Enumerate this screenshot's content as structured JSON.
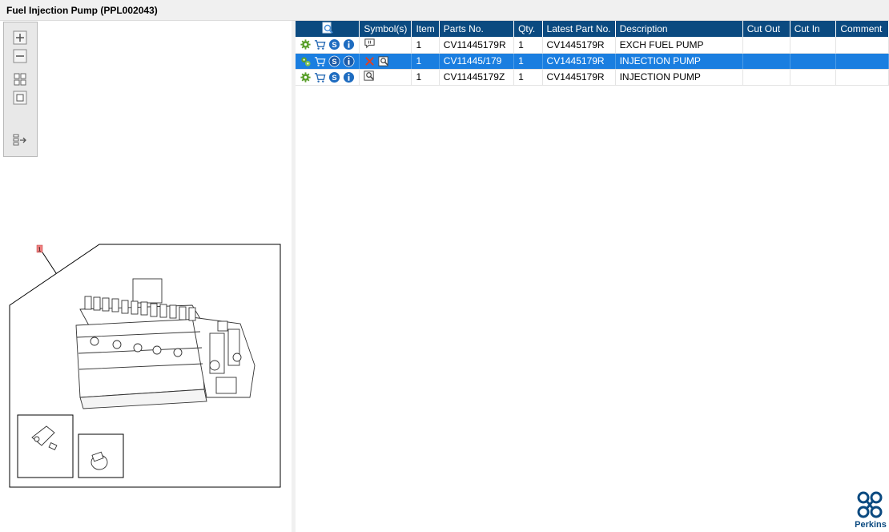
{
  "window": {
    "title": "Fuel Injection Pump (PPL002043)"
  },
  "toolbox": {
    "icons": [
      "zoom-in-icon",
      "zoom-out-icon",
      "fit-grid-icon",
      "fit-page-icon",
      "export-list-icon"
    ]
  },
  "diagram": {
    "callout": "1"
  },
  "parts_table": {
    "headers": {
      "symbols": "Symbol(s)",
      "item": "Item",
      "parts_no": "Parts No.",
      "qty": "Qty.",
      "latest": "Latest Part No.",
      "description": "Description",
      "cut_out": "Cut Out",
      "cut_in": "Cut In",
      "comment": "Comment"
    },
    "rows": [
      {
        "item": "1",
        "parts_no": "CV11445179R",
        "qty": "1",
        "latest": "CV1445179R",
        "description": "EXCH FUEL PUMP",
        "cut_out": "",
        "cut_in": "",
        "comment": "",
        "selected": false
      },
      {
        "item": "1",
        "parts_no": "CV11445/179",
        "qty": "1",
        "latest": "CV1445179R",
        "description": "INJECTION PUMP",
        "cut_out": "",
        "cut_in": "",
        "comment": "",
        "selected": true
      },
      {
        "item": "1",
        "parts_no": "CV11445179Z",
        "qty": "1",
        "latest": "CV1445179R",
        "description": "INJECTION PUMP",
        "cut_out": "",
        "cut_in": "",
        "comment": "",
        "selected": false
      }
    ]
  },
  "brand": {
    "name": "Perkins",
    "color": "#0b4a80"
  },
  "colors": {
    "header": "#0b4a80",
    "selection": "#1a7ee0"
  }
}
